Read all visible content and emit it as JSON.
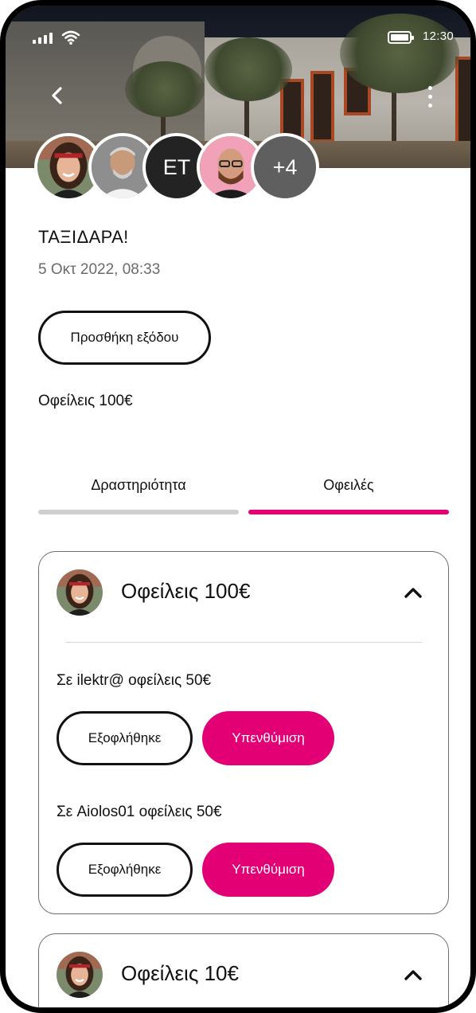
{
  "status_bar": {
    "time": "12:30"
  },
  "hero": {
    "back_icon": "chevron-left-icon",
    "menu_icon": "more-vertical-icon"
  },
  "participants": {
    "initials_avatar": "ET",
    "overflow_count": "+4"
  },
  "group": {
    "title": "ΤΑΞΙΔΑΡΑ!",
    "date": "5 Οκτ 2022, 08:33",
    "add_expense_label": "Προσθήκη εξόδου",
    "summary": "Οφείλεις 100€"
  },
  "tabs": [
    {
      "label": "Δραστηριότητα",
      "active": false
    },
    {
      "label": "Οφειλές",
      "active": true
    }
  ],
  "colors": {
    "accent": "#e20074",
    "inactive_tab": "#cfcfcf",
    "initials_bg": "#232323",
    "overflow_bg": "#5f5f5f"
  },
  "debts": [
    {
      "title": "Οφείλεις 100€",
      "expanded": true,
      "items": [
        {
          "text": "Σε ilektr@ οφείλεις 50€",
          "settled_label": "Εξοφλήθηκε",
          "remind_label": "Υπενθύμιση"
        },
        {
          "text": "Σε Aiolos01 οφείλεις 50€",
          "settled_label": "Εξοφλήθηκε",
          "remind_label": "Υπενθύμιση"
        }
      ]
    },
    {
      "title": "Οφείλεις 10€",
      "expanded": true,
      "items": []
    }
  ]
}
